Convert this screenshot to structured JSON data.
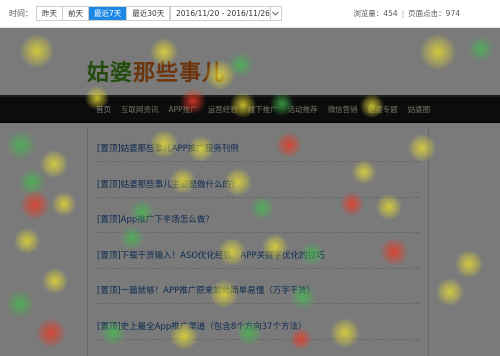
{
  "toolbar": {
    "time_label": "时间：",
    "ranges": [
      "昨天",
      "前天",
      "最近7天",
      "最近30天"
    ],
    "active_range": "最近7天",
    "date_range": "2016/11/20 - 2016/11/26",
    "pv_label": "浏览量：454",
    "sep": "|",
    "clicks_label": "页面点击：974"
  },
  "site": {
    "logo_part1": "姑婆",
    "logo_part2": "那些事儿",
    "nav": [
      "首页",
      "互联网资讯",
      "APP推广",
      "运营经验",
      "线下推广",
      "活动推荐",
      "微信营销",
      "姑婆专题",
      "姑婆圈"
    ]
  },
  "articles": [
    "[置顶]姑婆那些事儿APP推广服务刊例",
    "[置顶]姑婆那些事儿主要是做什么的？",
    "[置顶]App推广下半场怎么做？",
    "[置顶]下载干货输入！ASO优化经验：APP关键字优化的技巧",
    "[置顶]一篇就够！APP推广原来如此简单易懂（万字干货）",
    "[置顶]史上最全App推广渠道（包含8个方向37个方法）"
  ],
  "colors": {
    "accent": "#1e88e5",
    "logo_green": "#4a9e1a",
    "logo_orange": "#e06d1a",
    "navbar": "#1a1a1a",
    "link": "#1f5aa8",
    "heat_yellow": "#e1d737",
    "heat_green": "#46b950",
    "heat_red": "#e63c28"
  },
  "icons": {
    "date_dropdown": "chevron-down-icon"
  }
}
